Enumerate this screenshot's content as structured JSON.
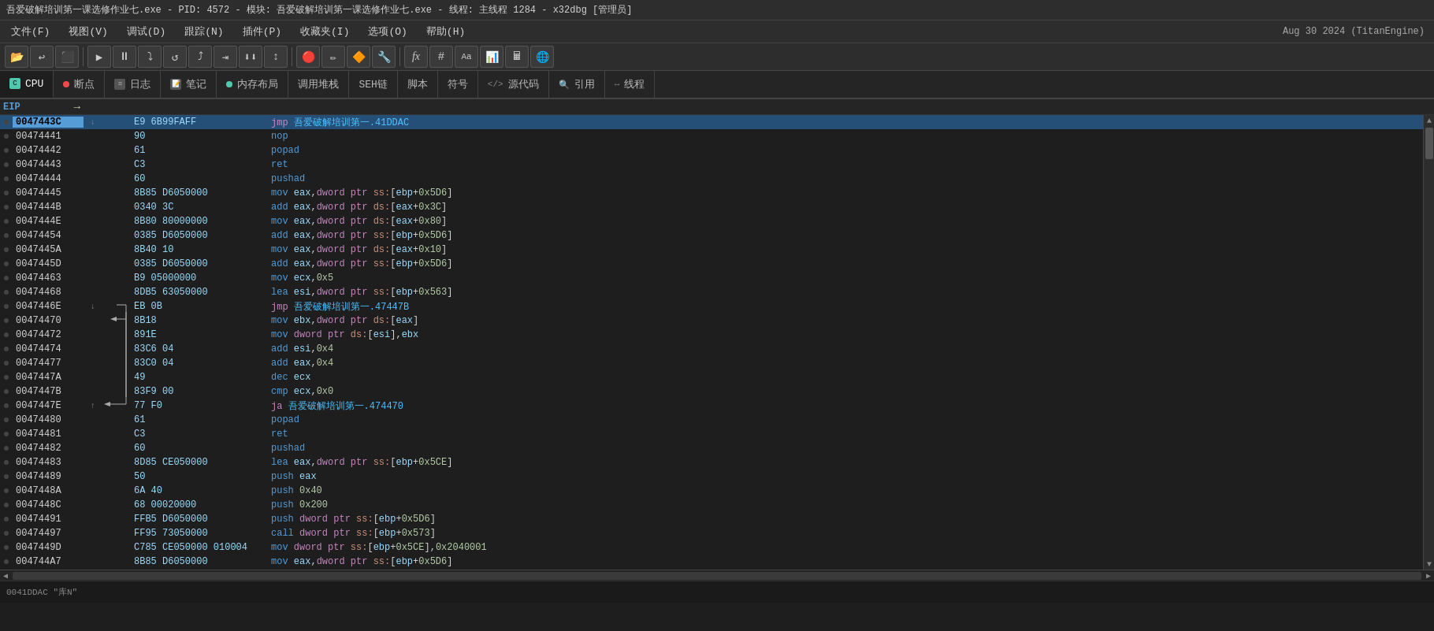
{
  "title": "吾爱破解培训第一课选修作业七.exe - PID: 4572 - 模块: 吾爱破解培训第一课选修作业七.exe - 线程: 主线程 1284 - x32dbg [管理员]",
  "menu": {
    "items": [
      "文件(F)",
      "视图(V)",
      "调试(D)",
      "跟踪(N)",
      "插件(P)",
      "收藏夹(I)",
      "选项(O)",
      "帮助(H)"
    ],
    "engine": "Aug 30 2024 (TitanEngine)"
  },
  "toolbar": {
    "buttons": [
      "📁",
      "↩",
      "⬜",
      "→",
      "⏸",
      "⬇",
      "↺",
      "⤷",
      "⬇⬇",
      "⬆",
      "↔",
      "🔴",
      "✏",
      "🔶",
      "🔧",
      "fx",
      "#",
      "Aa",
      "📊",
      "🖩",
      "🌐"
    ]
  },
  "tabs": [
    {
      "label": "CPU",
      "active": true,
      "dot_color": "#4ec9b0",
      "icon": "cpu"
    },
    {
      "label": "断点",
      "active": false,
      "dot_color": "#f44747",
      "icon": "breakpoint"
    },
    {
      "label": "日志",
      "active": false,
      "dot_color": "",
      "icon": "log"
    },
    {
      "label": "笔记",
      "active": false,
      "dot_color": "",
      "icon": "note"
    },
    {
      "label": "内存布局",
      "active": false,
      "dot_color": "#4ec9b0",
      "icon": "memory"
    },
    {
      "label": "调用堆栈",
      "active": false,
      "dot_color": "",
      "icon": "callstack"
    },
    {
      "label": "SEH链",
      "active": false,
      "dot_color": "",
      "icon": "seh"
    },
    {
      "label": "脚本",
      "active": false,
      "dot_color": "",
      "icon": "script"
    },
    {
      "label": "符号",
      "active": false,
      "dot_color": "",
      "icon": "symbol"
    },
    {
      "label": "源代码",
      "active": false,
      "dot_color": "",
      "icon": "source"
    },
    {
      "label": "引用",
      "active": false,
      "dot_color": "",
      "icon": "ref"
    },
    {
      "label": "线程",
      "active": false,
      "dot_color": "",
      "icon": "thread"
    }
  ],
  "eip_label": "EIP",
  "disasm_rows": [
    {
      "addr": "0047443C",
      "bytes": "E9 6B99FAFF",
      "disasm": "jmp 吾爱破解培训第一.41DDAC",
      "highlighted": true,
      "jump_down": true,
      "color": "jmp"
    },
    {
      "addr": "00474441",
      "bytes": "90",
      "disasm": "nop",
      "highlighted": false,
      "color": "plain"
    },
    {
      "addr": "00474442",
      "bytes": "61",
      "disasm": "popad",
      "highlighted": false,
      "color": "plain"
    },
    {
      "addr": "00474443",
      "bytes": "C3",
      "disasm": "ret",
      "highlighted": false,
      "color": "plain"
    },
    {
      "addr": "00474444",
      "bytes": "60",
      "disasm": "pushad",
      "highlighted": false,
      "color": "plain"
    },
    {
      "addr": "00474445",
      "bytes": "8B85 D6050000",
      "disasm": "mov eax,dword ptr ss:[ebp+0x5D6]",
      "highlighted": false,
      "color": "plain"
    },
    {
      "addr": "0047444B",
      "bytes": "0340 3C",
      "disasm": "add eax,dword ptr ds:[eax+0x3C]",
      "highlighted": false,
      "color": "plain"
    },
    {
      "addr": "0047444E",
      "bytes": "8B80 80000000",
      "disasm": "mov eax,dword ptr ds:[eax+0x80]",
      "highlighted": false,
      "color": "plain"
    },
    {
      "addr": "00474454",
      "bytes": "0385 D6050000",
      "disasm": "add eax,dword ptr ss:[ebp+0x5D6]",
      "highlighted": false,
      "color": "plain"
    },
    {
      "addr": "0047445A",
      "bytes": "8B40 10",
      "disasm": "mov eax,dword ptr ds:[eax+0x10]",
      "highlighted": false,
      "color": "plain"
    },
    {
      "addr": "0047445D",
      "bytes": "0385 D6050000",
      "disasm": "add eax,dword ptr ss:[ebp+0x5D6]",
      "highlighted": false,
      "color": "plain"
    },
    {
      "addr": "00474463",
      "bytes": "B9 05000000",
      "disasm": "mov ecx,0x5",
      "highlighted": false,
      "color": "plain"
    },
    {
      "addr": "00474468",
      "bytes": "8DB5 63050000",
      "disasm": "lea esi,dword ptr ss:[ebp+0x563]",
      "highlighted": false,
      "color": "plain"
    },
    {
      "addr": "0047446E",
      "bytes": "EB 0B",
      "disasm": "jmp 吾爱破解培训第一.47447B",
      "highlighted": false,
      "color": "jmp",
      "jump_down": true
    },
    {
      "addr": "00474470",
      "bytes": "8B18",
      "disasm": "mov ebx,dword ptr ds:[eax]",
      "highlighted": false,
      "color": "plain"
    },
    {
      "addr": "00474472",
      "bytes": "891E",
      "disasm": "mov dword ptr ds:[esi],ebx",
      "highlighted": false,
      "color": "plain"
    },
    {
      "addr": "00474474",
      "bytes": "83C6 04",
      "disasm": "add esi,0x4",
      "highlighted": false,
      "color": "plain"
    },
    {
      "addr": "00474477",
      "bytes": "83C0 04",
      "disasm": "add eax,0x4",
      "highlighted": false,
      "color": "plain"
    },
    {
      "addr": "0047447A",
      "bytes": "49",
      "disasm": "dec ecx",
      "highlighted": false,
      "color": "plain"
    },
    {
      "addr": "0047447B",
      "bytes": "83F9 00",
      "disasm": "cmp ecx,0x0",
      "highlighted": false,
      "color": "plain"
    },
    {
      "addr": "0047447E",
      "bytes": "77 F0",
      "disasm": "ja 吾爱破解培训第一.474470",
      "highlighted": false,
      "color": "jmp",
      "jump_up": true
    },
    {
      "addr": "00474480",
      "bytes": "61",
      "disasm": "popad",
      "highlighted": false,
      "color": "plain"
    },
    {
      "addr": "00474481",
      "bytes": "C3",
      "disasm": "ret",
      "highlighted": false,
      "color": "plain"
    },
    {
      "addr": "00474482",
      "bytes": "60",
      "disasm": "pushad",
      "highlighted": false,
      "color": "plain"
    },
    {
      "addr": "00474483",
      "bytes": "8D85 CE050000",
      "disasm": "lea eax,dword ptr ss:[ebp+0x5CE]",
      "highlighted": false,
      "color": "plain"
    },
    {
      "addr": "00474489",
      "bytes": "50",
      "disasm": "push eax",
      "highlighted": false,
      "color": "plain"
    },
    {
      "addr": "0047448A",
      "bytes": "6A 40",
      "disasm": "push 0x40",
      "highlighted": false,
      "color": "plain"
    },
    {
      "addr": "0047448C",
      "bytes": "68 00020000",
      "disasm": "push 0x200",
      "highlighted": false,
      "color": "plain"
    },
    {
      "addr": "00474491",
      "bytes": "FFB5 D6050000",
      "disasm": "push dword ptr ss:[ebp+0x5D6]",
      "highlighted": false,
      "color": "plain"
    },
    {
      "addr": "00474497",
      "bytes": "FF95 73050000",
      "disasm": "call dword ptr ss:[ebp+0x573]",
      "highlighted": false,
      "color": "plain"
    },
    {
      "addr": "0047449D",
      "bytes": "C785 CE050000 010004",
      "disasm": "mov dword ptr ss:[ebp+0x5CE],0x2040001",
      "highlighted": false,
      "color": "plain"
    },
    {
      "addr": "004744A7",
      "bytes": "8B85 D6050000",
      "disasm": "mov eax,dword ptr ss:[ebp+0x5D6]",
      "highlighted": false,
      "color": "plain"
    }
  ],
  "status_bar": {
    "text": "0041DDAC  \"库N\""
  }
}
